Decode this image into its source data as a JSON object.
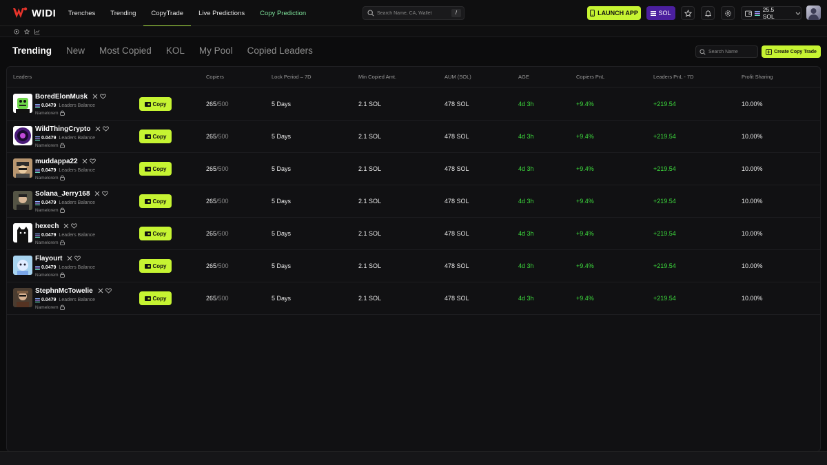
{
  "brand": {
    "name": "WIDI"
  },
  "nav": [
    {
      "label": "Trenches"
    },
    {
      "label": "Trending"
    },
    {
      "label": "CopyTrade"
    },
    {
      "label": "Live Predictions"
    },
    {
      "label": "Copy Prediction"
    }
  ],
  "header": {
    "search_placeholder": "Search Name, CA, Wallet",
    "search_shortcut": "/",
    "launch_label": "LAUNCH APP",
    "chain_label": "SOL",
    "wallet_balance": "25.5 SOL"
  },
  "tabs": [
    {
      "label": "Trending"
    },
    {
      "label": "New"
    },
    {
      "label": "Most Copied"
    },
    {
      "label": "KOL"
    },
    {
      "label": "My Pool"
    },
    {
      "label": "Copied Leaders"
    }
  ],
  "toolbar": {
    "search_placeholder": "Search Name",
    "create_label": "Create Copy Trade"
  },
  "table": {
    "headers": [
      "Leaders",
      "Copiers",
      "Lock Period – 7D",
      "Min Copied Amt.",
      "AUM (SOL)",
      "AGE",
      "Copiers PnL",
      "Leaders PnL - 7D",
      "Profit Sharing"
    ],
    "rows": [
      {
        "name": "BoredElonMusk",
        "balance": "0.0479",
        "balance_label": "Leaders Balance",
        "sub": "Namelorem",
        "copy_label": "Copy",
        "copiers": "265",
        "copiers_max": "/500",
        "lock": "5 Days",
        "min": "2.1 SOL",
        "aum": "478 SOL",
        "age": "4d 3h",
        "copiers_pnl": "+9.4%",
        "leaders_pnl": "+219.54",
        "profit": "10.00%"
      },
      {
        "name": "WildThingCrypto",
        "balance": "0.0479",
        "balance_label": "Leaders Balance",
        "sub": "Namelorem",
        "copy_label": "Copy",
        "copiers": "265",
        "copiers_max": "/500",
        "lock": "5 Days",
        "min": "2.1 SOL",
        "aum": "478 SOL",
        "age": "4d 3h",
        "copiers_pnl": "+9.4%",
        "leaders_pnl": "+219.54",
        "profit": "10.00%"
      },
      {
        "name": "muddappa22",
        "balance": "0.0479",
        "balance_label": "Leaders Balance",
        "sub": "Namelorem",
        "copy_label": "Copy",
        "copiers": "265",
        "copiers_max": "/500",
        "lock": "5 Days",
        "min": "2.1 SOL",
        "aum": "478 SOL",
        "age": "4d 3h",
        "copiers_pnl": "+9.4%",
        "leaders_pnl": "+219.54",
        "profit": "10.00%"
      },
      {
        "name": "Solana_Jerry168",
        "balance": "0.0479",
        "balance_label": "Leaders Balance",
        "sub": "Namelorem",
        "copy_label": "Copy",
        "copiers": "265",
        "copiers_max": "/500",
        "lock": "5 Days",
        "min": "2.1 SOL",
        "aum": "478 SOL",
        "age": "4d 3h",
        "copiers_pnl": "+9.4%",
        "leaders_pnl": "+219.54",
        "profit": "10.00%"
      },
      {
        "name": "hexech",
        "balance": "0.0479",
        "balance_label": "Leaders Balance",
        "sub": "Namelorem",
        "copy_label": "Copy",
        "copiers": "265",
        "copiers_max": "/500",
        "lock": "5 Days",
        "min": "2.1 SOL",
        "aum": "478 SOL",
        "age": "4d 3h",
        "copiers_pnl": "+9.4%",
        "leaders_pnl": "+219.54",
        "profit": "10.00%"
      },
      {
        "name": "Flayourt",
        "balance": "0.0479",
        "balance_label": "Leaders Balance",
        "sub": "Namelorem",
        "copy_label": "Copy",
        "copiers": "265",
        "copiers_max": "/500",
        "lock": "5 Days",
        "min": "2.1 SOL",
        "aum": "478 SOL",
        "age": "4d 3h",
        "copiers_pnl": "+9.4%",
        "leaders_pnl": "+219.54",
        "profit": "10.00%"
      },
      {
        "name": "StephnMcTowelie",
        "balance": "0.0479",
        "balance_label": "Leaders Balance",
        "sub": "Namelorem",
        "copy_label": "Copy",
        "copiers": "265",
        "copiers_max": "/500",
        "lock": "5 Days",
        "min": "2.1 SOL",
        "aum": "478 SOL",
        "age": "4d 3h",
        "copiers_pnl": "+9.4%",
        "leaders_pnl": "+219.54",
        "profit": "10.00%"
      }
    ]
  },
  "colors": {
    "accent": "#c6f432",
    "positive": "#3ddc3d",
    "purple": "#4b1f9e"
  }
}
